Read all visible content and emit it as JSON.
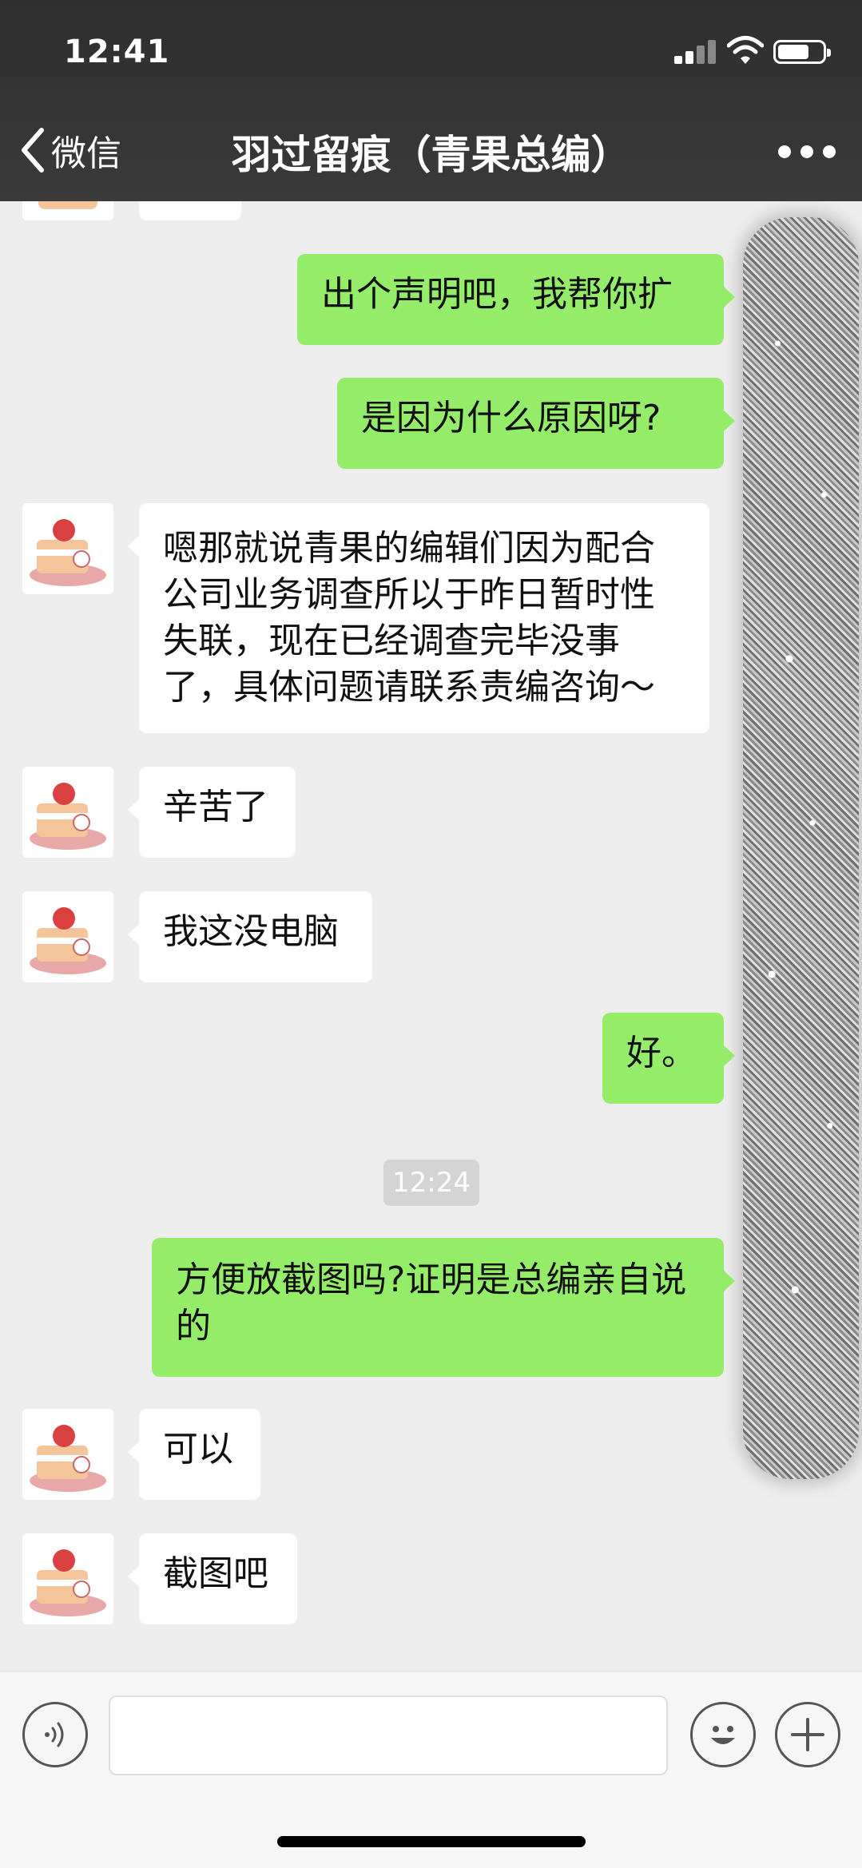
{
  "status_bar": {
    "time": "12:41"
  },
  "nav": {
    "back_label": "微信",
    "title": "羽过留痕（青果总编）"
  },
  "messages": [
    {
      "side": "out",
      "text": "出个声明吧，我帮你扩"
    },
    {
      "side": "out",
      "text": "是因为什么原因呀?"
    },
    {
      "side": "in",
      "text": "嗯那就说青果的编辑们因为配合公司业务调查所以于昨日暂时性失联，现在已经调查完毕没事了，具体问题请联系责编咨询～"
    },
    {
      "side": "in",
      "text": "辛苦了"
    },
    {
      "side": "in",
      "text": "我这没电脑"
    },
    {
      "side": "out",
      "text": "好。"
    },
    {
      "side": "out",
      "text": "方便放截图吗?证明是总编亲自说的"
    },
    {
      "side": "in",
      "text": "可以"
    },
    {
      "side": "in",
      "text": "截图吧"
    }
  ],
  "timestamp": "12:24",
  "input": {
    "placeholder": ""
  },
  "colors": {
    "header": "#363636",
    "chat_bg": "#ededed",
    "outgoing_bubble": "#95ec69",
    "incoming_bubble": "#ffffff"
  }
}
